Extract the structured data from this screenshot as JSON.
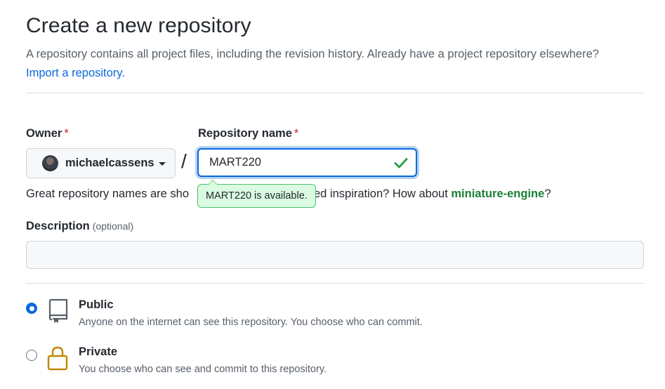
{
  "page": {
    "title": "Create a new repository",
    "subtitle": "A repository contains all project files, including the revision history. Already have a project repository elsewhere?",
    "import_link": "Import a repository."
  },
  "owner": {
    "label": "Owner",
    "required_mark": "*",
    "username": "michaelcassens"
  },
  "separator": "/",
  "repo_name": {
    "label": "Repository name",
    "required_mark": "*",
    "value": "MART220",
    "availability": "MART220 is available.",
    "valid_icon": "check-icon"
  },
  "hint": {
    "lead": "Great repository names are sho",
    "tail_text": "ed inspiration? How about ",
    "suggestion": "miniature-engine",
    "tail_end": "?"
  },
  "description": {
    "label": "Description",
    "optional": "(optional)",
    "value": ""
  },
  "visibility": {
    "options": [
      {
        "label": "Public",
        "description": "Anyone on the internet can see this repository. You choose who can commit.",
        "selected": true,
        "icon": "repo-icon"
      },
      {
        "label": "Private",
        "description": "You choose who can see and commit to this repository.",
        "selected": false,
        "icon": "lock-icon"
      }
    ]
  },
  "colors": {
    "accent": "#0969da",
    "success": "#1a7f37",
    "danger": "#cf222e",
    "private_icon": "#bf8700"
  }
}
